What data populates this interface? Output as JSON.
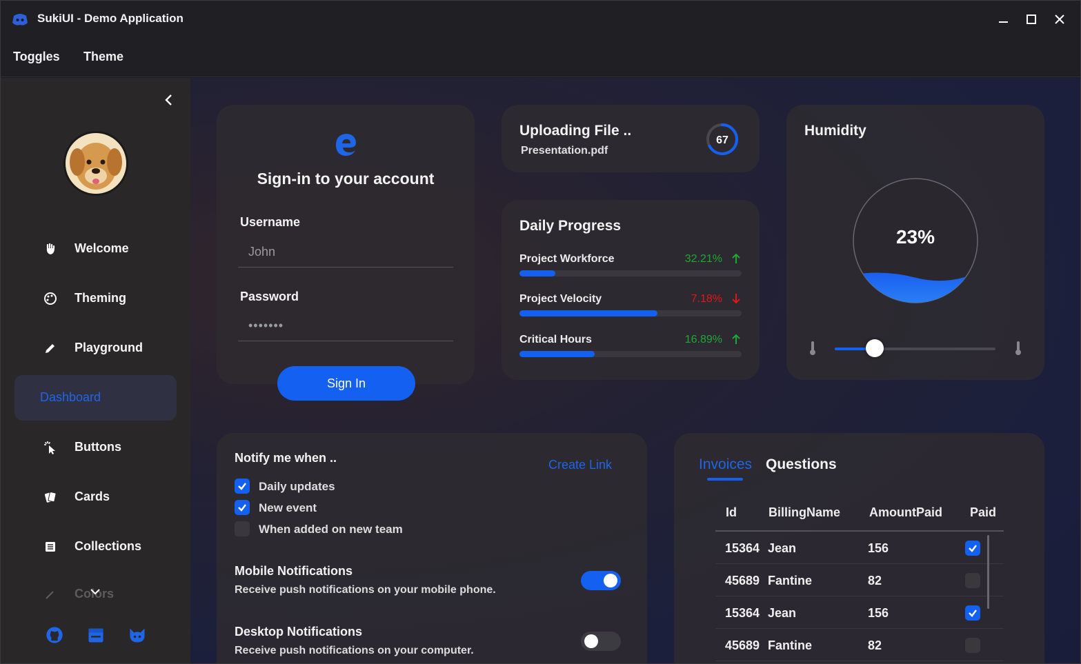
{
  "window": {
    "title": "SukiUI - Demo Application"
  },
  "menu": [
    "Toggles",
    "Theme"
  ],
  "sidebar": {
    "items": [
      {
        "label": "Welcome",
        "icon": "hand-icon"
      },
      {
        "label": "Theming",
        "icon": "palette-icon"
      },
      {
        "label": "Playground",
        "icon": "pencil-icon"
      },
      {
        "label": "Dashboard",
        "icon": "",
        "active": true
      },
      {
        "label": "Buttons",
        "icon": "pointer-click-icon"
      },
      {
        "label": "Cards",
        "icon": "cards-icon"
      },
      {
        "label": "Collections",
        "icon": "list-icon"
      },
      {
        "label": "Colors",
        "icon": "brush-icon"
      }
    ],
    "footer_icons": [
      "github-icon",
      "store-icon",
      "cat-icon"
    ]
  },
  "signin": {
    "heading": "Sign-in to your account",
    "username_label": "Username",
    "username_value": "John",
    "password_label": "Password",
    "password_value": "•••••••",
    "button": "Sign In"
  },
  "upload": {
    "title": "Uploading File ..",
    "file": "Presentation.pdf",
    "progress": 67
  },
  "daily": {
    "title": "Daily Progress",
    "rows": [
      {
        "label": "Project Workforce",
        "value": "32.21%",
        "trend": "up",
        "fill": 0.16,
        "color": "#1fa835"
      },
      {
        "label": "Project Velocity",
        "value": "7.18%",
        "trend": "down",
        "fill": 0.62,
        "color": "#e01818"
      },
      {
        "label": "Critical Hours",
        "value": "16.89%",
        "trend": "up",
        "fill": 0.34,
        "color": "#1fa835"
      }
    ]
  },
  "humidity": {
    "title": "Humidity",
    "value": "23%",
    "level": 0.23,
    "slider": 0.25
  },
  "notify": {
    "title": "Notify me when ..",
    "link": "Create Link",
    "checks": [
      {
        "label": "Daily updates",
        "checked": true
      },
      {
        "label": "New event",
        "checked": true
      },
      {
        "label": "When added on new team",
        "checked": false
      }
    ],
    "mobile": {
      "title": "Mobile Notifications",
      "desc": "Receive push notifications on your mobile phone.",
      "on": true
    },
    "desktop": {
      "title": "Desktop Notifications",
      "desc": "Receive push notifications on your computer.",
      "on": false
    }
  },
  "tables": {
    "tabs": [
      "Invoices",
      "Questions"
    ],
    "headers": [
      "Id",
      "BillingName",
      "AmountPaid",
      "Paid"
    ],
    "rows": [
      {
        "id": "15364",
        "name": "Jean",
        "amount": "156",
        "paid": true
      },
      {
        "id": "45689",
        "name": "Fantine",
        "amount": "82",
        "paid": false
      },
      {
        "id": "15364",
        "name": "Jean",
        "amount": "156",
        "paid": true
      },
      {
        "id": "45689",
        "name": "Fantine",
        "amount": "82",
        "paid": false
      }
    ]
  },
  "colors": {
    "accent": "#1460f0",
    "up": "#1fa835",
    "down": "#e01818"
  }
}
